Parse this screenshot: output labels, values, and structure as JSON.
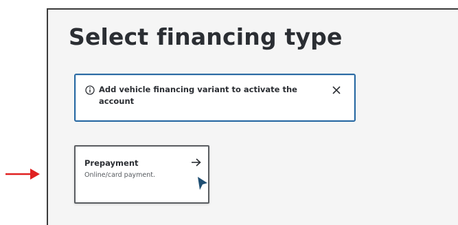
{
  "page": {
    "title": "Select financing type"
  },
  "alert": {
    "icon": "info-icon",
    "message": "Add vehicle financing variant to activate the account",
    "close_icon": "close-icon"
  },
  "financing_options": [
    {
      "label": "Prepayment",
      "description": "Online/card payment.",
      "icon": "arrow-right-icon"
    }
  ],
  "annotation": {
    "arrow_icon": "red-pointer-arrow-icon",
    "color": "#e02020"
  },
  "colors": {
    "alert_border": "#2a6aa3",
    "title_text": "#2b2e33",
    "cursor": "#1f4f73"
  }
}
